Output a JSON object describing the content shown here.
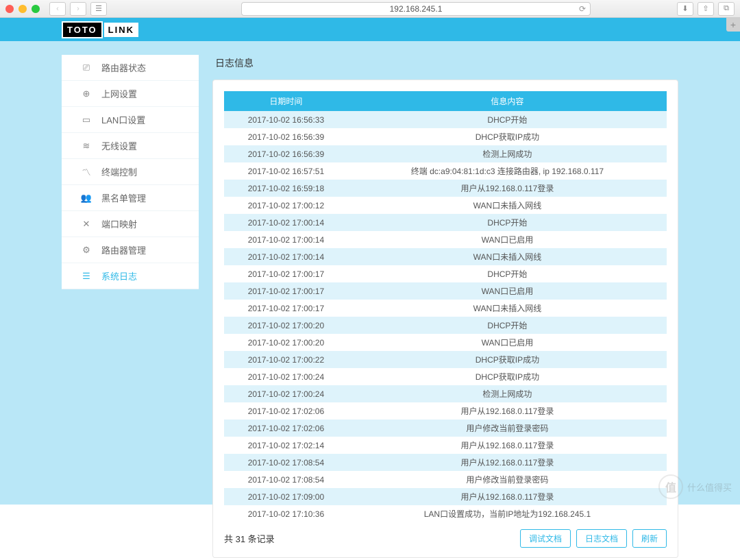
{
  "browser": {
    "url": "192.168.245.1"
  },
  "logo": {
    "part1": "TOTO",
    "part2": "LINK"
  },
  "sidebar": {
    "items": [
      {
        "label": "路由器状态",
        "icon": "router-status-icon"
      },
      {
        "label": "上网设置",
        "icon": "globe-icon"
      },
      {
        "label": "LAN口设置",
        "icon": "lan-icon"
      },
      {
        "label": "无线设置",
        "icon": "wifi-icon"
      },
      {
        "label": "终端控制",
        "icon": "terminal-icon"
      },
      {
        "label": "黑名单管理",
        "icon": "blacklist-icon"
      },
      {
        "label": "端口映射",
        "icon": "portmap-icon"
      },
      {
        "label": "路由器管理",
        "icon": "settings-icon"
      },
      {
        "label": "系统日志",
        "icon": "syslog-icon"
      }
    ],
    "activeIndex": 8
  },
  "main": {
    "title": "日志信息",
    "columns": {
      "datetime": "日期时间",
      "content": "信息内容"
    },
    "rows": [
      {
        "t": "2017-10-02 16:56:33",
        "c": "DHCP开始"
      },
      {
        "t": "2017-10-02 16:56:39",
        "c": "DHCP获取IP成功"
      },
      {
        "t": "2017-10-02 16:56:39",
        "c": "检测上网成功"
      },
      {
        "t": "2017-10-02 16:57:51",
        "c": "终端 dc:a9:04:81:1d:c3 连接路由器, ip 192.168.0.117"
      },
      {
        "t": "2017-10-02 16:59:18",
        "c": "用户从192.168.0.117登录"
      },
      {
        "t": "2017-10-02 17:00:12",
        "c": "WAN口未插入网线"
      },
      {
        "t": "2017-10-02 17:00:14",
        "c": "DHCP开始"
      },
      {
        "t": "2017-10-02 17:00:14",
        "c": "WAN口已启用"
      },
      {
        "t": "2017-10-02 17:00:14",
        "c": "WAN口未插入网线"
      },
      {
        "t": "2017-10-02 17:00:17",
        "c": "DHCP开始"
      },
      {
        "t": "2017-10-02 17:00:17",
        "c": "WAN口已启用"
      },
      {
        "t": "2017-10-02 17:00:17",
        "c": "WAN口未插入网线"
      },
      {
        "t": "2017-10-02 17:00:20",
        "c": "DHCP开始"
      },
      {
        "t": "2017-10-02 17:00:20",
        "c": "WAN口已启用"
      },
      {
        "t": "2017-10-02 17:00:22",
        "c": "DHCP获取IP成功"
      },
      {
        "t": "2017-10-02 17:00:24",
        "c": "DHCP获取IP成功"
      },
      {
        "t": "2017-10-02 17:00:24",
        "c": "检测上网成功"
      },
      {
        "t": "2017-10-02 17:02:06",
        "c": "用户从192.168.0.117登录"
      },
      {
        "t": "2017-10-02 17:02:06",
        "c": "用户修改当前登录密码"
      },
      {
        "t": "2017-10-02 17:02:14",
        "c": "用户从192.168.0.117登录"
      },
      {
        "t": "2017-10-02 17:08:54",
        "c": "用户从192.168.0.117登录"
      },
      {
        "t": "2017-10-02 17:08:54",
        "c": "用户修改当前登录密码"
      },
      {
        "t": "2017-10-02 17:09:00",
        "c": "用户从192.168.0.117登录"
      },
      {
        "t": "2017-10-02 17:10:36",
        "c": "LAN口设置成功，当前IP地址为192.168.245.1"
      }
    ],
    "footer": {
      "count_text": "共 31 条记录",
      "buttons": {
        "debug": "调试文档",
        "log": "日志文档",
        "refresh": "刷新"
      }
    }
  },
  "watermark": {
    "text": "什么值得买",
    "badge": "值"
  }
}
